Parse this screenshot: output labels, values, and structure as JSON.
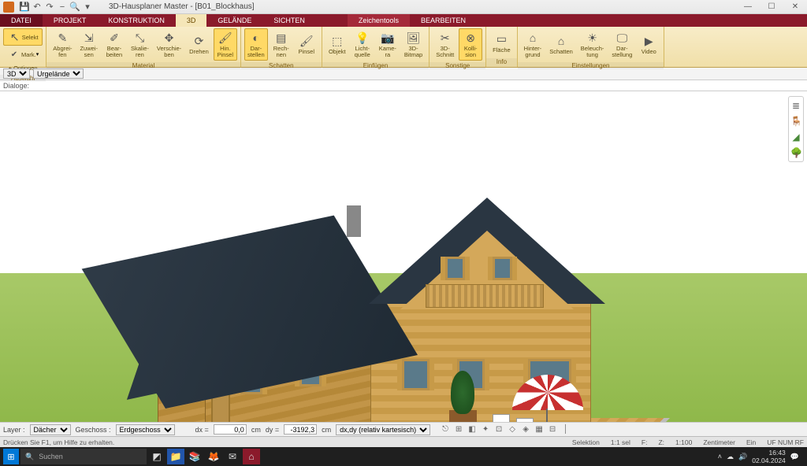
{
  "title": "3D-Hausplaner Master - [B01_Blockhaus]",
  "tabs": {
    "file": "DATEI",
    "list": [
      "PROJEKT",
      "KONSTRUKTION",
      "3D",
      "GELÄNDE",
      "SICHTEN"
    ],
    "active_index": 2,
    "context": "Zeichentools",
    "context_sub": "BEARBEITEN"
  },
  "ribbon": {
    "auswahl": {
      "label": "Auswahl",
      "selekt": "Selekt",
      "mark": "Mark.",
      "optionen": "Optionen"
    },
    "material": {
      "label": "Material",
      "buttons": [
        "Abgrei-\nfen",
        "Zuwei-\nsen",
        "Bear-\nbeiten",
        "Skalie-\nren",
        "Verschie-\nben",
        "Drehen",
        "Hin.\nPinsel"
      ]
    },
    "schatten": {
      "label": "Schatten",
      "buttons": [
        "Dar-\nstellen",
        "Rech-\nnen",
        "Pinsel"
      ]
    },
    "einfuegen": {
      "label": "Einfügen",
      "buttons": [
        "Objekt",
        "Licht-\nquelle",
        "Kame-\nra",
        "3D-\nBitmap"
      ]
    },
    "sonstige": {
      "label": "Sonstige",
      "buttons": [
        "3D-\nSchnitt",
        "Kolli-\nsion"
      ]
    },
    "info": {
      "label": "Info",
      "buttons": [
        "Fläche"
      ]
    },
    "einstellungen": {
      "label": "Einstellungen",
      "buttons": [
        "Hinter-\ngrund",
        "Schatten",
        "Beleuch-\ntung",
        "Dar-\nstellung",
        "Video"
      ]
    }
  },
  "subbar": {
    "view": "3D",
    "layer": "Urgelände"
  },
  "dialoge": "Dialoge:",
  "bottombar": {
    "layer_lbl": "Layer :",
    "layer_val": "Dächer",
    "geschoss_lbl": "Geschoss :",
    "geschoss_val": "Erdgeschoss",
    "dx_lbl": "dx =",
    "dx_val": "0,0",
    "unit": "cm",
    "dy_lbl": "dy =",
    "dy_val": "-3192,3",
    "mode": "dx,dy (relativ kartesisch)"
  },
  "status": {
    "help": "Drücken Sie F1, um Hilfe zu erhalten.",
    "selektion": "Selektion",
    "sel": "1:1 sel",
    "f": "F:",
    "z": "Z:",
    "scale": "1:100",
    "unit": "Zentimeter",
    "ein": "Ein",
    "caps": "UF  NUM  RF"
  },
  "taskbar": {
    "search_placeholder": "Suchen",
    "time": "16:43",
    "date": "02.04.2024"
  }
}
